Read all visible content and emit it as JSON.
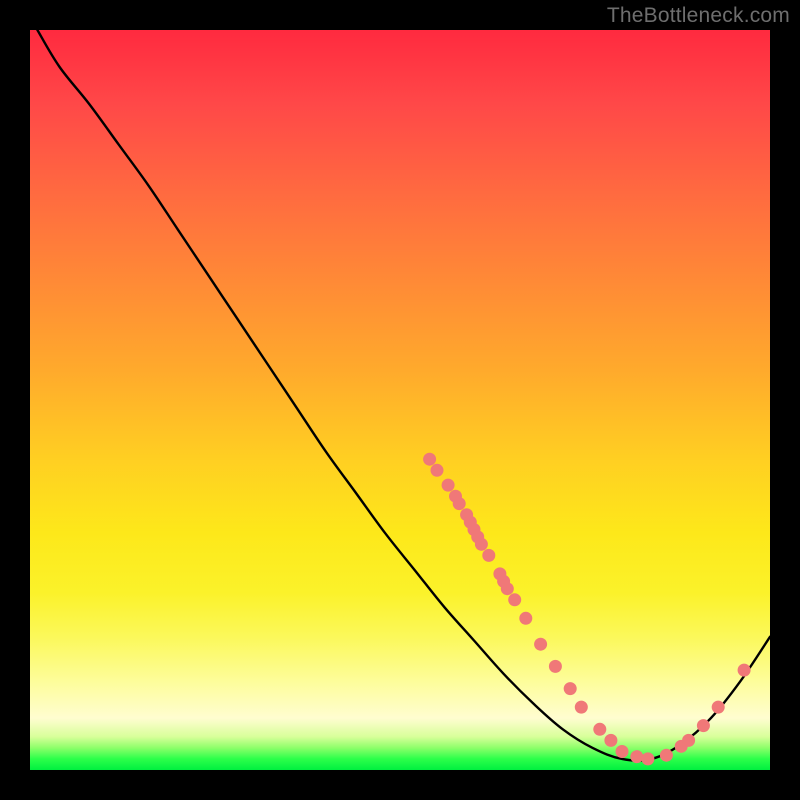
{
  "attribution": "TheBottleneck.com",
  "chart_data": {
    "type": "line",
    "title": "",
    "xlabel": "",
    "ylabel": "",
    "xlim": [
      0,
      100
    ],
    "ylim": [
      0,
      100
    ],
    "grid": false,
    "legend": false,
    "series": [
      {
        "name": "curve",
        "x": [
          1,
          4,
          8,
          12,
          16,
          20,
          24,
          28,
          32,
          36,
          40,
          44,
          48,
          52,
          56,
          60,
          64,
          68,
          72,
          76,
          80,
          84,
          88,
          92,
          96,
          100
        ],
        "y": [
          100,
          95,
          90,
          84.5,
          79,
          73,
          67,
          61,
          55,
          49,
          43,
          37.5,
          32,
          27,
          22,
          17.5,
          13,
          9,
          5.5,
          3,
          1.5,
          1.5,
          3.5,
          7,
          12,
          18
        ]
      }
    ],
    "markers": [
      {
        "x": 54,
        "y": 42
      },
      {
        "x": 55,
        "y": 40.5
      },
      {
        "x": 56.5,
        "y": 38.5
      },
      {
        "x": 57.5,
        "y": 37
      },
      {
        "x": 58,
        "y": 36
      },
      {
        "x": 59,
        "y": 34.5
      },
      {
        "x": 59.5,
        "y": 33.5
      },
      {
        "x": 60,
        "y": 32.5
      },
      {
        "x": 60.5,
        "y": 31.5
      },
      {
        "x": 61,
        "y": 30.5
      },
      {
        "x": 62,
        "y": 29
      },
      {
        "x": 63.5,
        "y": 26.5
      },
      {
        "x": 64,
        "y": 25.5
      },
      {
        "x": 64.5,
        "y": 24.5
      },
      {
        "x": 65.5,
        "y": 23
      },
      {
        "x": 67,
        "y": 20.5
      },
      {
        "x": 69,
        "y": 17
      },
      {
        "x": 71,
        "y": 14
      },
      {
        "x": 73,
        "y": 11
      },
      {
        "x": 74.5,
        "y": 8.5
      },
      {
        "x": 77,
        "y": 5.5
      },
      {
        "x": 78.5,
        "y": 4
      },
      {
        "x": 80,
        "y": 2.5
      },
      {
        "x": 82,
        "y": 1.8
      },
      {
        "x": 83.5,
        "y": 1.5
      },
      {
        "x": 86,
        "y": 2
      },
      {
        "x": 88,
        "y": 3.2
      },
      {
        "x": 89,
        "y": 4
      },
      {
        "x": 91,
        "y": 6
      },
      {
        "x": 93,
        "y": 8.5
      },
      {
        "x": 96.5,
        "y": 13.5
      }
    ],
    "marker_color": "#f07878",
    "marker_radius": 6.5,
    "curve_color": "#000000",
    "curve_width": 2.4
  }
}
